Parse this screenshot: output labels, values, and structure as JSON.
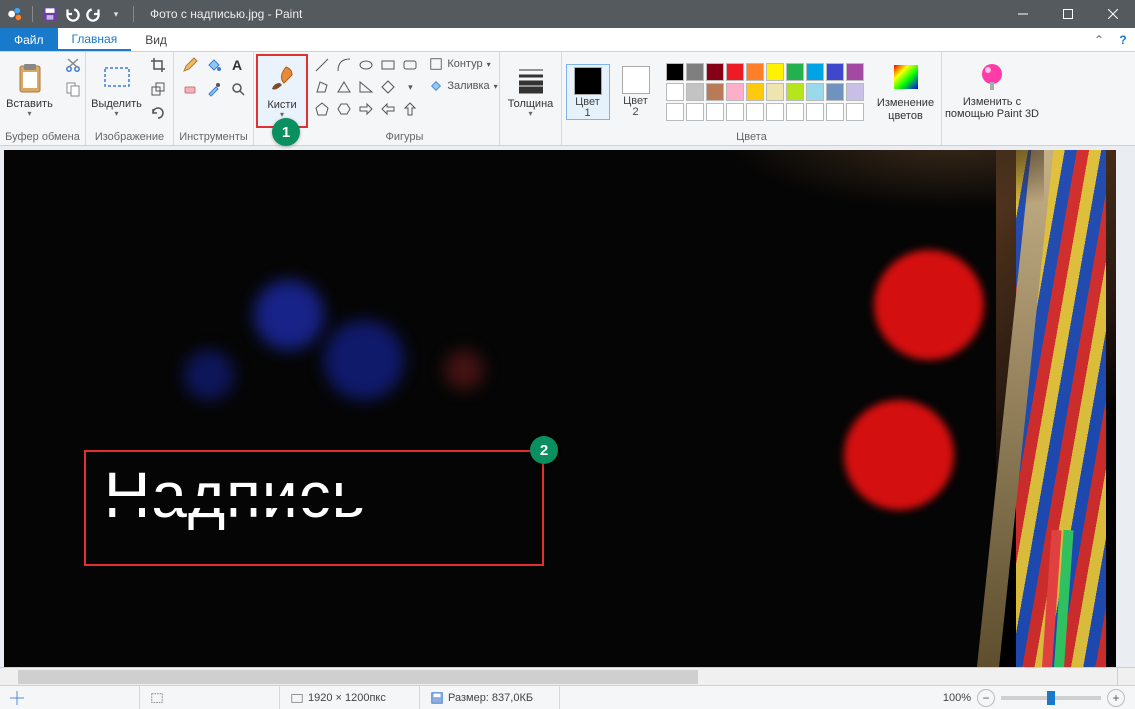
{
  "title": "Фото с надписью.jpg - Paint",
  "tabs": {
    "file": "Файл",
    "home": "Главная",
    "view": "Вид"
  },
  "groups": {
    "clipboard": {
      "paste": "Вставить",
      "label": "Буфер обмена"
    },
    "image": {
      "select": "Выделить",
      "label": "Изображение"
    },
    "tools": {
      "label": "Инструменты"
    },
    "brushes": {
      "btn": "Кисти"
    },
    "shapes": {
      "outline": "Контур",
      "fill": "Заливка",
      "label": "Фигуры"
    },
    "size": {
      "btn": "Толщина"
    },
    "colors": {
      "c1": "Цвет\n1",
      "c2": "Цвет\n2",
      "edit": "Изменение\nцветов",
      "label": "Цвета"
    },
    "paint3d": {
      "btn": "Изменить с\nпомощью Paint 3D"
    }
  },
  "palette_row1": [
    "#000000",
    "#7f7f7f",
    "#880015",
    "#ed1c24",
    "#ff7f27",
    "#fff200",
    "#22b14c",
    "#00a2e8",
    "#3f48cc",
    "#a349a4"
  ],
  "palette_row2": [
    "#ffffff",
    "#c3c3c3",
    "#b97a57",
    "#ffaec9",
    "#ffc90e",
    "#efe4b0",
    "#b5e61d",
    "#99d9ea",
    "#7092be",
    "#c8bfe7"
  ],
  "color1": "#000000",
  "color2": "#ffffff",
  "annotations": {
    "a1": "1",
    "a2": "2"
  },
  "canvas_caption": "Надпись",
  "status": {
    "dims": "1920 × 1200пкс",
    "size_label": "Размер: 837,0КБ",
    "zoom": "100%"
  }
}
